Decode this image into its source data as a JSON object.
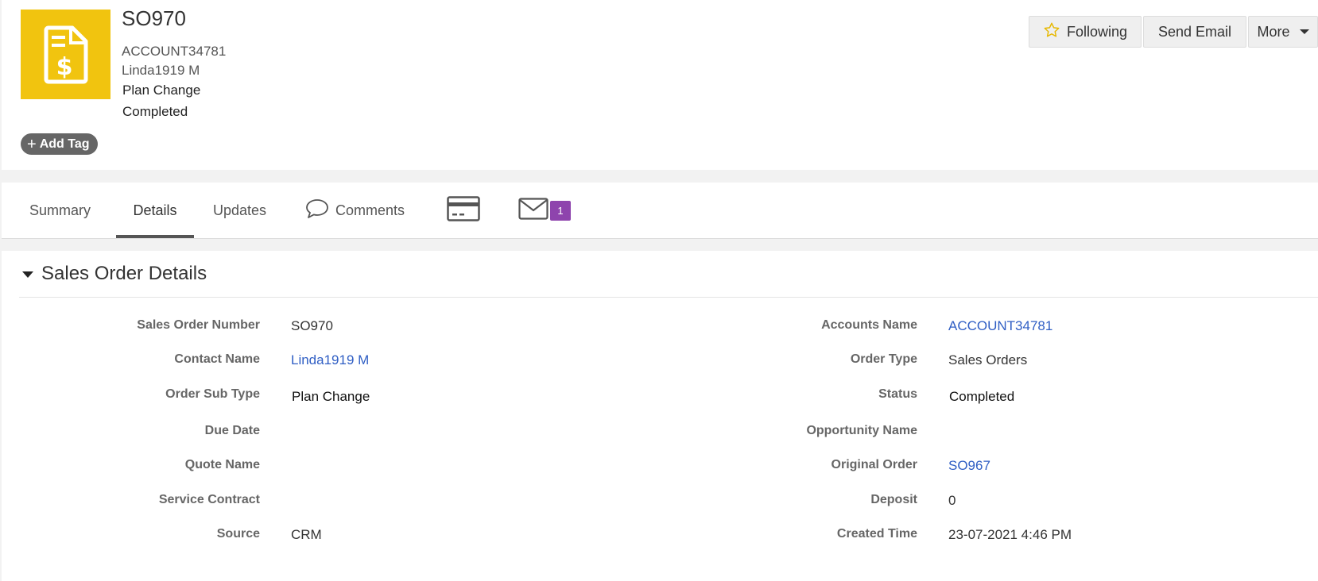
{
  "header": {
    "title": "SO970",
    "account": "ACCOUNT34781",
    "contact": "Linda1919 M",
    "order_sub_type": "Plan Change",
    "status": "Completed",
    "add_tag_label": "Add Tag",
    "accent": "#f1c40f"
  },
  "actions": {
    "following": "Following",
    "send_email": "Send Email",
    "more": "More"
  },
  "tabs": {
    "summary": "Summary",
    "details": "Details",
    "updates": "Updates",
    "comments": "Comments",
    "mail_badge": "1"
  },
  "section": {
    "title": "Sales Order Details"
  },
  "fields": {
    "sales_order_number": {
      "label": "Sales Order Number",
      "value": "SO970"
    },
    "contact_name": {
      "label": "Contact Name",
      "value": "Linda1919 M"
    },
    "order_sub_type": {
      "label": "Order Sub Type",
      "value": "Plan Change"
    },
    "due_date": {
      "label": "Due Date",
      "value": ""
    },
    "quote_name": {
      "label": "Quote Name",
      "value": ""
    },
    "service_contract": {
      "label": "Service Contract",
      "value": ""
    },
    "source": {
      "label": "Source",
      "value": "CRM"
    },
    "accounts_name": {
      "label": "Accounts Name",
      "value": "ACCOUNT34781"
    },
    "order_type": {
      "label": "Order Type",
      "value": "Sales Orders"
    },
    "status": {
      "label": "Status",
      "value": "Completed"
    },
    "opportunity_name": {
      "label": "Opportunity Name",
      "value": ""
    },
    "original_order": {
      "label": "Original Order",
      "value": "SO967"
    },
    "deposit": {
      "label": "Deposit",
      "value": "0"
    },
    "created_time": {
      "label": "Created Time",
      "value": "23-07-2021 4:46 PM"
    }
  }
}
